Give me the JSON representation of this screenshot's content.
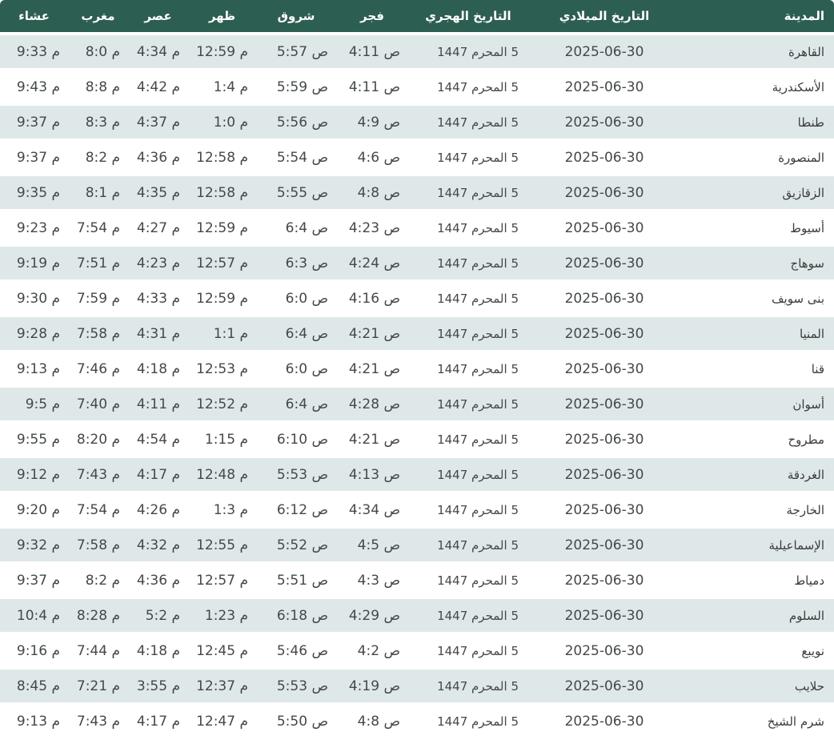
{
  "colors": {
    "header_bg": "#2d5e52",
    "header_text": "#ffffff",
    "row_alt_bg": "#dfe8e9",
    "row_bg": "#ffffff",
    "time_text": "#43484b",
    "city_text": "#3b3b3b"
  },
  "table": {
    "columns": [
      {
        "key": "city",
        "label": "المدينة"
      },
      {
        "key": "gregorian",
        "label": "التاريخ الميلادي"
      },
      {
        "key": "hijri",
        "label": "التاريخ الهجري"
      },
      {
        "key": "fajr",
        "label": "فجر"
      },
      {
        "key": "sunrise",
        "label": "شروق"
      },
      {
        "key": "dhuhr",
        "label": "ظهر"
      },
      {
        "key": "asr",
        "label": "عصر"
      },
      {
        "key": "maghrib",
        "label": "مغرب"
      },
      {
        "key": "isha",
        "label": "عشاء"
      }
    ],
    "rows": [
      {
        "city": "القاهرة",
        "gregorian": "2025-06-30",
        "hijri": "5 المحرم 1447",
        "fajr": "4:11 ص",
        "sunrise": "5:57 ص",
        "dhuhr": "12:59 م",
        "asr": "4:34 م",
        "maghrib": "8:0 م",
        "isha": "9:33 م"
      },
      {
        "city": "الأسكندرية",
        "gregorian": "2025-06-30",
        "hijri": "5 المحرم 1447",
        "fajr": "4:11 ص",
        "sunrise": "5:59 ص",
        "dhuhr": "1:4 م",
        "asr": "4:42 م",
        "maghrib": "8:8 م",
        "isha": "9:43 م"
      },
      {
        "city": "طنطا",
        "gregorian": "2025-06-30",
        "hijri": "5 المحرم 1447",
        "fajr": "4:9 ص",
        "sunrise": "5:56 ص",
        "dhuhr": "1:0 م",
        "asr": "4:37 م",
        "maghrib": "8:3 م",
        "isha": "9:37 م"
      },
      {
        "city": "المنصورة",
        "gregorian": "2025-06-30",
        "hijri": "5 المحرم 1447",
        "fajr": "4:6 ص",
        "sunrise": "5:54 ص",
        "dhuhr": "12:58 م",
        "asr": "4:36 م",
        "maghrib": "8:2 م",
        "isha": "9:37 م"
      },
      {
        "city": "الزقازيق",
        "gregorian": "2025-06-30",
        "hijri": "5 المحرم 1447",
        "fajr": "4:8 ص",
        "sunrise": "5:55 ص",
        "dhuhr": "12:58 م",
        "asr": "4:35 م",
        "maghrib": "8:1 م",
        "isha": "9:35 م"
      },
      {
        "city": "أسيوط",
        "gregorian": "2025-06-30",
        "hijri": "5 المحرم 1447",
        "fajr": "4:23 ص",
        "sunrise": "6:4 ص",
        "dhuhr": "12:59 م",
        "asr": "4:27 م",
        "maghrib": "7:54 م",
        "isha": "9:23 م"
      },
      {
        "city": "سوهاج",
        "gregorian": "2025-06-30",
        "hijri": "5 المحرم 1447",
        "fajr": "4:24 ص",
        "sunrise": "6:3 ص",
        "dhuhr": "12:57 م",
        "asr": "4:23 م",
        "maghrib": "7:51 م",
        "isha": "9:19 م"
      },
      {
        "city": "بنى سويف",
        "gregorian": "2025-06-30",
        "hijri": "5 المحرم 1447",
        "fajr": "4:16 ص",
        "sunrise": "6:0 ص",
        "dhuhr": "12:59 م",
        "asr": "4:33 م",
        "maghrib": "7:59 م",
        "isha": "9:30 م"
      },
      {
        "city": "المنيا",
        "gregorian": "2025-06-30",
        "hijri": "5 المحرم 1447",
        "fajr": "4:21 ص",
        "sunrise": "6:4 ص",
        "dhuhr": "1:1 م",
        "asr": "4:31 م",
        "maghrib": "7:58 م",
        "isha": "9:28 م"
      },
      {
        "city": "قنا",
        "gregorian": "2025-06-30",
        "hijri": "5 المحرم 1447",
        "fajr": "4:21 ص",
        "sunrise": "6:0 ص",
        "dhuhr": "12:53 م",
        "asr": "4:18 م",
        "maghrib": "7:46 م",
        "isha": "9:13 م"
      },
      {
        "city": "أسوان",
        "gregorian": "2025-06-30",
        "hijri": "5 المحرم 1447",
        "fajr": "4:28 ص",
        "sunrise": "6:4 ص",
        "dhuhr": "12:52 م",
        "asr": "4:11 م",
        "maghrib": "7:40 م",
        "isha": "9:5 م"
      },
      {
        "city": "مطروح",
        "gregorian": "2025-06-30",
        "hijri": "5 المحرم 1447",
        "fajr": "4:21 ص",
        "sunrise": "6:10 ص",
        "dhuhr": "1:15 م",
        "asr": "4:54 م",
        "maghrib": "8:20 م",
        "isha": "9:55 م"
      },
      {
        "city": "الغردقة",
        "gregorian": "2025-06-30",
        "hijri": "5 المحرم 1447",
        "fajr": "4:13 ص",
        "sunrise": "5:53 ص",
        "dhuhr": "12:48 م",
        "asr": "4:17 م",
        "maghrib": "7:43 م",
        "isha": "9:12 م"
      },
      {
        "city": "الخارجة",
        "gregorian": "2025-06-30",
        "hijri": "5 المحرم 1447",
        "fajr": "4:34 ص",
        "sunrise": "6:12 ص",
        "dhuhr": "1:3 م",
        "asr": "4:26 م",
        "maghrib": "7:54 م",
        "isha": "9:20 م"
      },
      {
        "city": "الإسماعيلية",
        "gregorian": "2025-06-30",
        "hijri": "5 المحرم 1447",
        "fajr": "4:5 ص",
        "sunrise": "5:52 ص",
        "dhuhr": "12:55 م",
        "asr": "4:32 م",
        "maghrib": "7:58 م",
        "isha": "9:32 م"
      },
      {
        "city": "دمياط",
        "gregorian": "2025-06-30",
        "hijri": "5 المحرم 1447",
        "fajr": "4:3 ص",
        "sunrise": "5:51 ص",
        "dhuhr": "12:57 م",
        "asr": "4:36 م",
        "maghrib": "8:2 م",
        "isha": "9:37 م"
      },
      {
        "city": "السلوم",
        "gregorian": "2025-06-30",
        "hijri": "5 المحرم 1447",
        "fajr": "4:29 ص",
        "sunrise": "6:18 ص",
        "dhuhr": "1:23 م",
        "asr": "5:2 م",
        "maghrib": "8:28 م",
        "isha": "10:4 م"
      },
      {
        "city": "نويبع",
        "gregorian": "2025-06-30",
        "hijri": "5 المحرم 1447",
        "fajr": "4:2 ص",
        "sunrise": "5:46 ص",
        "dhuhr": "12:45 م",
        "asr": "4:18 م",
        "maghrib": "7:44 م",
        "isha": "9:16 م"
      },
      {
        "city": "حلايب",
        "gregorian": "2025-06-30",
        "hijri": "5 المحرم 1447",
        "fajr": "4:19 ص",
        "sunrise": "5:53 ص",
        "dhuhr": "12:37 م",
        "asr": "3:55 م",
        "maghrib": "7:21 م",
        "isha": "8:45 م"
      },
      {
        "city": "شرم الشيخ",
        "gregorian": "2025-06-30",
        "hijri": "5 المحرم 1447",
        "fajr": "4:8 ص",
        "sunrise": "5:50 ص",
        "dhuhr": "12:47 م",
        "asr": "4:17 م",
        "maghrib": "7:43 م",
        "isha": "9:13 م"
      }
    ]
  }
}
